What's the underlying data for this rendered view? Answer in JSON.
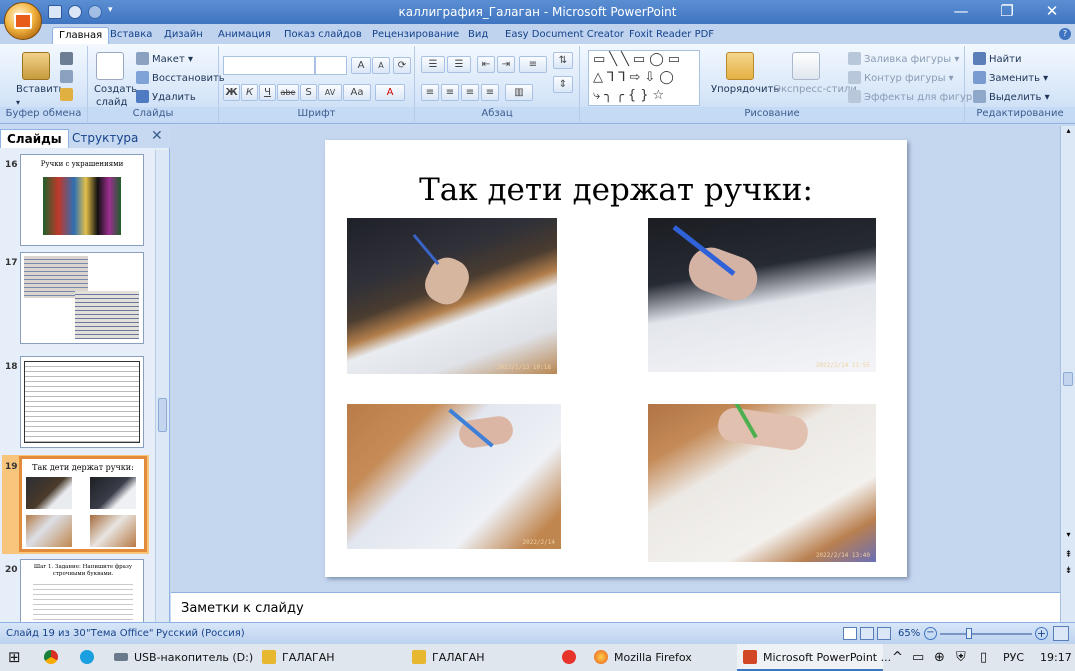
{
  "window": {
    "title": "каллиграфия_Галаган - Microsoft PowerPoint",
    "controls": [
      "—",
      "❐",
      "✕"
    ]
  },
  "tabs": [
    "Главная",
    "Вставка",
    "Дизайн",
    "Анимация",
    "Показ слайдов",
    "Рецензирование",
    "Вид",
    "Easy Document Creator",
    "Foxit Reader PDF"
  ],
  "ribbon": {
    "clipboard": {
      "paste": "Вставить",
      "label": "Буфер обмена"
    },
    "slides": {
      "new_slide_1": "Создать",
      "new_slide_2": "слайд",
      "layout": "Макет",
      "reset": "Восстановить",
      "delete": "Удалить",
      "label": "Слайды"
    },
    "font": {
      "grow": "A",
      "shrink": "A",
      "bold": "Ж",
      "italic": "К",
      "underline": "Ч",
      "strike": "abe",
      "shadow": "S",
      "spacing": "AV",
      "case": "Aa",
      "color": "A",
      "label": "Шрифт"
    },
    "paragraph": {
      "label": "Абзац"
    },
    "drawing": {
      "arrange": "Упорядочить",
      "quick_styles": "Экспресс-стили",
      "fill": "Заливка фигуры",
      "outline": "Контур фигуры",
      "effects": "Эффекты для фигур",
      "label": "Рисование"
    },
    "editing": {
      "find": "Найти",
      "replace": "Заменить",
      "select": "Выделить",
      "label": "Редактирование"
    }
  },
  "left_panel": {
    "tab_slides": "Слайды",
    "tab_outline": "Структура",
    "thumbnails": [
      {
        "number": "16",
        "title": "Ручки с украшениями"
      },
      {
        "number": "17",
        "title": ""
      },
      {
        "number": "18",
        "title": ""
      },
      {
        "number": "19",
        "title": "Так дети держат ручки:"
      },
      {
        "number": "20",
        "title": "Шаг 1. Задание: Напишите фразу строчными буквами."
      }
    ]
  },
  "slide": {
    "title": "Так дети держат ручки:",
    "photos": [
      {
        "stamp": "2022/1/13 10:18"
      },
      {
        "stamp": "2022/2/14 11:55"
      },
      {
        "stamp": "2022/2/14"
      },
      {
        "stamp": "2022/2/14 13:40"
      }
    ]
  },
  "notes": {
    "placeholder": "Заметки к слайду"
  },
  "status": {
    "slide_counter": "Слайд 19 из 30",
    "theme": "\"Тема Office\"",
    "language": "Русский (Россия)",
    "zoom": "65%"
  },
  "taskbar": {
    "items": [
      "USB-накопитель (D:)",
      "ГАЛАГАН",
      "ГАЛАГАН",
      "Mozilla Firefox",
      "Microsoft PowerPoint ..."
    ],
    "lang": "РУС",
    "time": "19:17"
  },
  "colors": {
    "accent": "#3f74c1",
    "selection": "#e28c3b",
    "ribbon_text": "#15428b"
  }
}
